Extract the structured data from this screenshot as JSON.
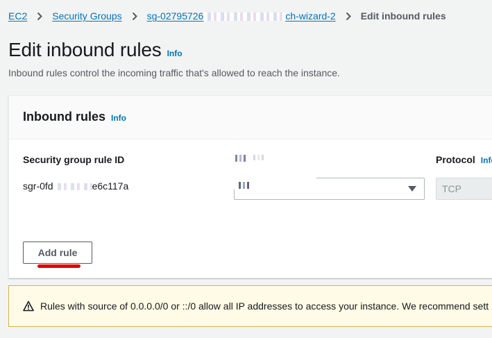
{
  "breadcrumb": {
    "items": [
      {
        "label": "EC2"
      },
      {
        "label": "Security Groups"
      },
      {
        "label_start": "sg-02795726",
        "label_end": "ch-wizard-2"
      }
    ],
    "current": "Edit inbound rules"
  },
  "page": {
    "title": "Edit inbound rules",
    "info": "Info",
    "description": "Inbound rules control the incoming traffic that's allowed to reach the instance."
  },
  "panel": {
    "title": "Inbound rules",
    "info": "Info",
    "columns": {
      "rule_id": "Security group rule ID",
      "protocol": "Protocol",
      "protocol_info": "Info"
    },
    "row": {
      "rule_id_start": "sgr-0fd",
      "rule_id_end": "e6c117a",
      "protocol_value": "TCP"
    },
    "add_rule_label": "Add rule"
  },
  "alert": {
    "icon": "warning-icon",
    "text": "Rules with source of 0.0.0.0/0 or ::/0 allow all IP addresses to access your instance. We recommend sett"
  },
  "colors": {
    "link": "#0073bb",
    "annotation_underline": "#e00000",
    "alert_background": "#fffbe6"
  }
}
